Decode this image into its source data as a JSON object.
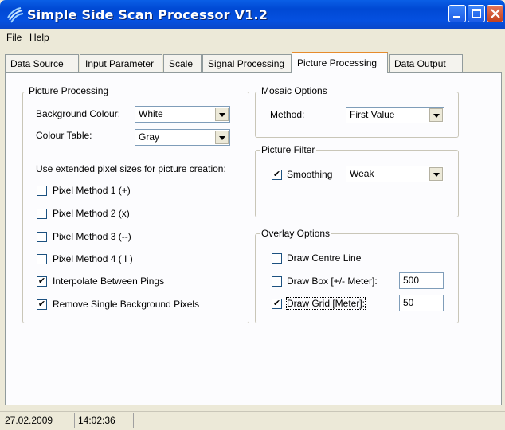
{
  "window": {
    "title": "Simple Side Scan Processor V1.2"
  },
  "menu": {
    "file": "File",
    "help": "Help"
  },
  "tabs": [
    {
      "label": "Data Source"
    },
    {
      "label": "Input Parameter"
    },
    {
      "label": "Scale"
    },
    {
      "label": "Signal Processing"
    },
    {
      "label": "Picture Processing"
    },
    {
      "label": "Data Output"
    }
  ],
  "picture_processing": {
    "title": "Picture Processing",
    "background_colour_label": "Background Colour:",
    "background_colour_value": "White",
    "colour_table_label": "Colour Table:",
    "colour_table_value": "Gray",
    "extended_label": "Use extended pixel sizes for picture creation:",
    "options": [
      {
        "label": "Pixel Method 1 (+)",
        "checked": false
      },
      {
        "label": "Pixel Method 2 (x)",
        "checked": false
      },
      {
        "label": "Pixel Method 3 (--)",
        "checked": false
      },
      {
        "label": "Pixel Method 4 ( I )",
        "checked": false
      },
      {
        "label": "Interpolate Between Pings",
        "checked": true
      },
      {
        "label": "Remove Single Background Pixels",
        "checked": true
      }
    ]
  },
  "mosaic": {
    "title": "Mosaic Options",
    "method_label": "Method:",
    "method_value": "First Value"
  },
  "filter": {
    "title": "Picture Filter",
    "smoothing_label": "Smoothing",
    "smoothing_checked": true,
    "smoothing_value": "Weak"
  },
  "overlay": {
    "title": "Overlay Options",
    "centre_line_label": "Draw Centre Line",
    "centre_line_checked": false,
    "box_label": "Draw Box [+/- Meter]:",
    "box_checked": false,
    "box_value": "500",
    "grid_label": "Draw Grid [Meter]:",
    "grid_checked": true,
    "grid_value": "50"
  },
  "status": {
    "date": "27.02.2009",
    "time": "14:02:36"
  },
  "check_mark": "✔"
}
